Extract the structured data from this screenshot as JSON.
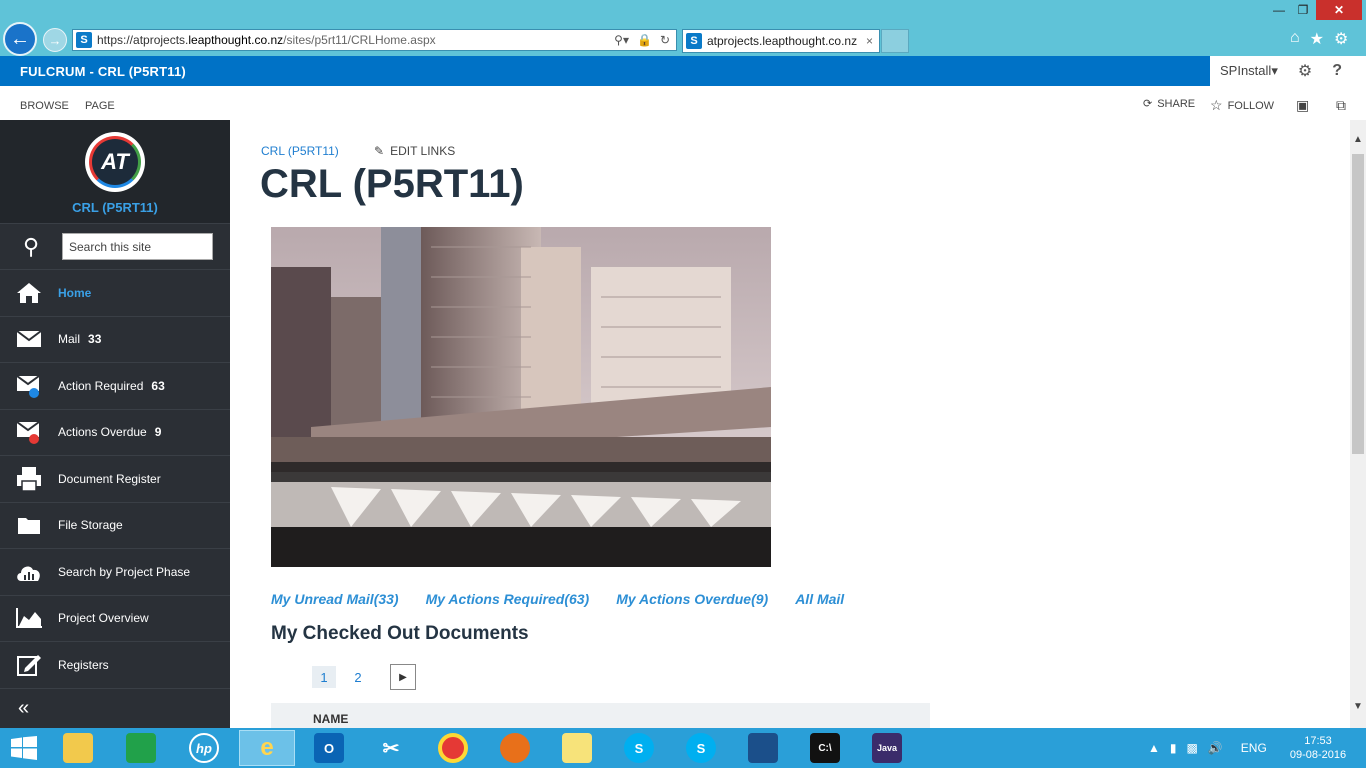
{
  "browser": {
    "url_prefix": "https://atprojects.",
    "url_domain": "leapthought.co.nz",
    "url_path": "/sites/p5rt11/CRLHome.aspx",
    "tab_title": "atprojects.leapthought.co.nz",
    "tab_close": "×",
    "favicon": "S"
  },
  "suitebar": {
    "title": "FULCRUM - CRL (P5RT11)",
    "user": "SPInstall",
    "help": "?"
  },
  "ribbon": {
    "browse": "BROWSE",
    "page": "PAGE",
    "share": "SHARE",
    "follow": "FOLLOW"
  },
  "sidebar": {
    "logo_text": "AT",
    "site_name": "CRL (P5RT11)",
    "search_placeholder": "Search this site",
    "items": [
      {
        "label": "Home",
        "count": "",
        "icon": "home-icon"
      },
      {
        "label": "Mail",
        "count": "33",
        "icon": "mail-icon"
      },
      {
        "label": "Action Required",
        "count": "63",
        "icon": "mail-info-icon"
      },
      {
        "label": "Actions Overdue",
        "count": "9",
        "icon": "mail-alert-icon"
      },
      {
        "label": "Document Register",
        "count": "",
        "icon": "printer-icon"
      },
      {
        "label": "File Storage",
        "count": "",
        "icon": "folder-icon"
      },
      {
        "label": "Search by Project Phase",
        "count": "",
        "icon": "cloud-chart-icon"
      },
      {
        "label": "Project Overview",
        "count": "",
        "icon": "area-chart-icon"
      },
      {
        "label": "Registers",
        "count": "",
        "icon": "edit-icon"
      }
    ],
    "collapse": "«"
  },
  "main": {
    "breadcrumb": "CRL (P5RT11)",
    "edit_links": "EDIT LINKS",
    "title": "CRL (P5RT11)",
    "quick_links": [
      "My Unread Mail(33)",
      "My Actions Required(63)",
      "My Actions Overdue(9)",
      "All Mail"
    ],
    "section_title": "My Checked Out Documents",
    "pages": [
      "1",
      "2"
    ],
    "table_header": "NAME"
  },
  "taskbar": {
    "language": "ENG",
    "time": "17:53",
    "date": "09-08-2016"
  },
  "colors": {
    "ie_chrome": "#5fc3d8",
    "suitebar": "#0072c6",
    "sidebar": "#2b2f35",
    "accent": "#3aa0e6",
    "taskbar": "#2a9fd8"
  }
}
